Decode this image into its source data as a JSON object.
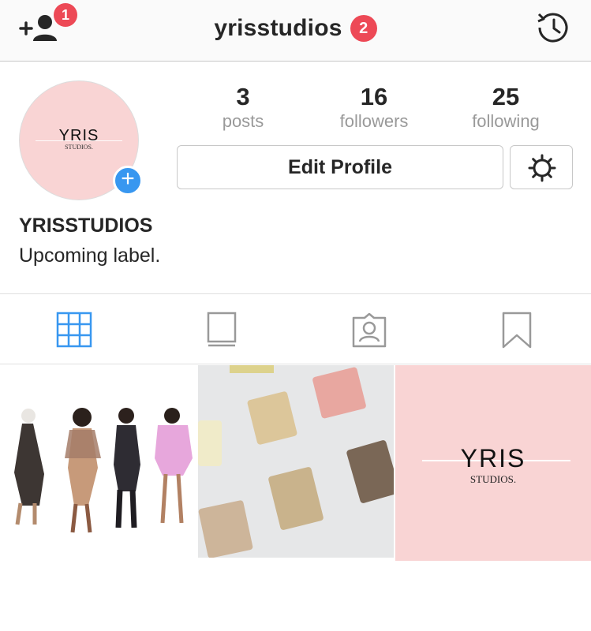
{
  "header": {
    "username": "yrisstudios",
    "username_badge": "2",
    "add_user_badge": "1",
    "icons": {
      "add_user": "add-person-icon",
      "history": "history-icon"
    }
  },
  "profile": {
    "avatar_logo_main": "YRIS",
    "avatar_logo_sub": "STUDIOS.",
    "stats": [
      {
        "value": "3",
        "label": "posts"
      },
      {
        "value": "16",
        "label": "followers"
      },
      {
        "value": "25",
        "label": "following"
      }
    ],
    "edit_label": "Edit Profile",
    "name": "YRISSTUDIOS",
    "bio": "Upcoming label."
  },
  "tabs": [
    {
      "icon": "grid-icon",
      "active": true
    },
    {
      "icon": "list-icon",
      "active": false
    },
    {
      "icon": "tagged-icon",
      "active": false
    },
    {
      "icon": "bookmark-icon",
      "active": false
    }
  ],
  "posts": [
    {
      "subject": "fashion-illustration"
    },
    {
      "subject": "fabric-swatches"
    },
    {
      "logo_main": "YRIS",
      "logo_sub": "STUDIOS."
    }
  ],
  "colors": {
    "accent": "#3897f0",
    "badge": "#ed4956",
    "brand_pink": "#f9d4d4"
  }
}
